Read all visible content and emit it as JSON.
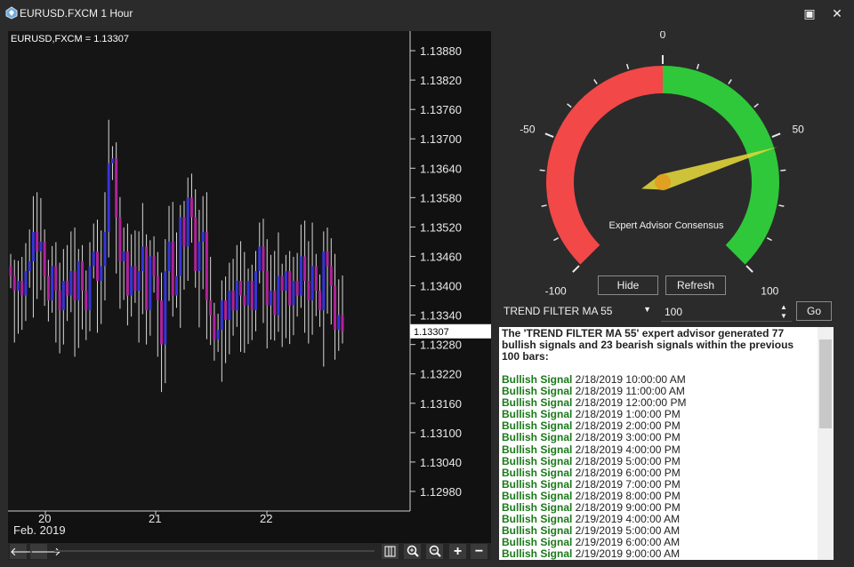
{
  "window": {
    "title": "EURUSD.FXCM 1 Hour",
    "maximize_glyph": "▣",
    "close_glyph": "✕",
    "icon": "app-logo-icon"
  },
  "chart": {
    "header": "EURUSD,FXCM = 1.13307",
    "current_price": "1.13307",
    "y_ticks": [
      "1.13880",
      "1.13820",
      "1.13760",
      "1.13700",
      "1.13640",
      "1.13580",
      "1.13520",
      "1.13460",
      "1.13400",
      "1.13340",
      "1.13280",
      "1.13220",
      "1.13160",
      "1.13100",
      "1.13040",
      "1.12980"
    ],
    "x_ticks": [
      "20",
      "21",
      "22"
    ],
    "x_sub": "Feb. 2019",
    "colors": {
      "up": "#3535d8",
      "down": "#b0229a",
      "wick": "#d8d8d8",
      "bg": "#111111"
    }
  },
  "chart_data": {
    "type": "candlestick",
    "ylim": [
      1.1294,
      1.1392
    ],
    "y_ticks": [
      1.1388,
      1.1382,
      1.1376,
      1.137,
      1.1364,
      1.1358,
      1.1352,
      1.1346,
      1.134,
      1.1334,
      1.1328,
      1.1322,
      1.1316,
      1.131,
      1.1304,
      1.1298
    ],
    "x_labels": [
      "20",
      "21",
      "22"
    ],
    "x_sub_label": "Feb. 2019",
    "last_price": 1.13307,
    "closes": [
      1.1342,
      1.1339,
      1.1341,
      1.1338,
      1.1343,
      1.1345,
      1.1351,
      1.1347,
      1.1349,
      1.1342,
      1.1337,
      1.1344,
      1.1339,
      1.1335,
      1.1341,
      1.1338,
      1.1343,
      1.1337,
      1.1345,
      1.1339,
      1.1335,
      1.1344,
      1.1347,
      1.1341,
      1.1344,
      1.1351,
      1.1365,
      1.1366,
      1.1354,
      1.1345,
      1.1347,
      1.1338,
      1.1344,
      1.1339,
      1.1343,
      1.1348,
      1.1335,
      1.1346,
      1.1342,
      1.1337,
      1.1328,
      1.1343,
      1.1349,
      1.1338,
      1.1342,
      1.1354,
      1.1348,
      1.1358,
      1.1354,
      1.1343,
      1.1349,
      1.1351,
      1.1337,
      1.1334,
      1.1329,
      1.1331,
      1.1337,
      1.1333,
      1.1339,
      1.1335,
      1.1341,
      1.1338,
      1.1336,
      1.1341,
      1.1335,
      1.1343,
      1.1348,
      1.1343,
      1.1336,
      1.1339,
      1.1334,
      1.1342,
      1.1339,
      1.1343,
      1.1336,
      1.1341,
      1.1338,
      1.1346,
      1.1341,
      1.1337,
      1.1344,
      1.1339,
      1.1335,
      1.1347,
      1.1344,
      1.134,
      1.1331,
      1.1334,
      1.13307
    ]
  },
  "gauge": {
    "label": "Expert Advisor Consensus",
    "min": -100,
    "max": 100,
    "value": 54,
    "tick_labels": {
      "zero": "0",
      "neg50": "-50",
      "pos50": "50",
      "min": "-100",
      "max": "100"
    },
    "colors": {
      "negative": "#f24848",
      "positive": "#2fc83a",
      "needle": "#e0d43a",
      "hub": "#e0a020"
    }
  },
  "buttons": {
    "hide": "Hide",
    "refresh": "Refresh",
    "go": "Go"
  },
  "advisor_select": {
    "value": "TREND FILTER MA 55"
  },
  "bars_input": {
    "value": "100"
  },
  "log": {
    "summary": "The 'TREND FILTER MA 55' expert advisor generated 77 bullish signals and 23 bearish signals within the previous 100 bars:",
    "signal_label": "Bullish Signal",
    "entries": [
      "2/18/2019 10:00:00 AM",
      "2/18/2019 11:00:00 AM",
      "2/18/2019 12:00:00 PM",
      "2/18/2019 1:00:00 PM",
      "2/18/2019 2:00:00 PM",
      "2/18/2019 3:00:00 PM",
      "2/18/2019 4:00:00 PM",
      "2/18/2019 5:00:00 PM",
      "2/18/2019 6:00:00 PM",
      "2/18/2019 7:00:00 PM",
      "2/18/2019 8:00:00 PM",
      "2/18/2019 9:00:00 PM",
      "2/19/2019 4:00:00 AM",
      "2/19/2019 5:00:00 AM",
      "2/19/2019 6:00:00 AM",
      "2/19/2019 9:00:00 AM"
    ]
  },
  "toolbar": {
    "scroll_left": "🡐",
    "scroll_right": "🡒",
    "columns_icon": "columns-icon",
    "zoom_in": "zoom-in-icon",
    "zoom_out": "zoom-out-icon",
    "plus": "+",
    "minus": "−"
  }
}
